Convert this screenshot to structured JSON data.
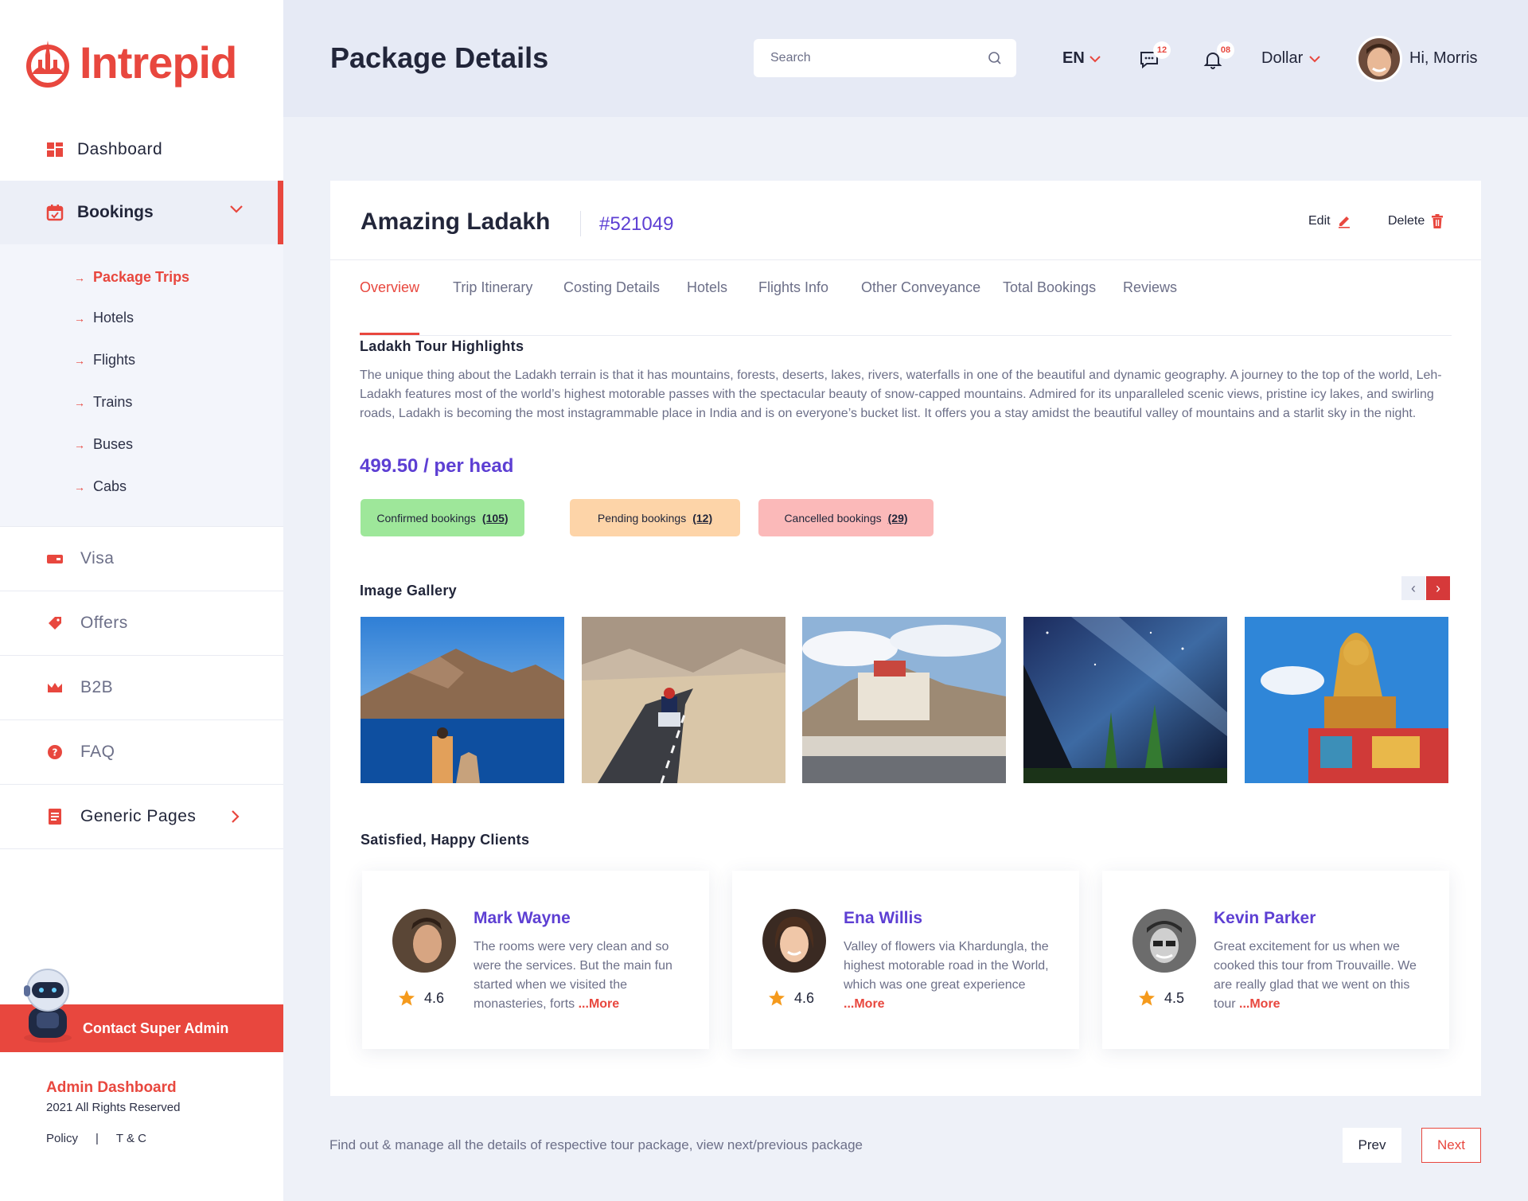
{
  "brand": {
    "name": "Intrepid",
    "accent": "#e8473e",
    "purple": "#5d3fd3"
  },
  "sidebar": {
    "items": [
      {
        "label": "Dashboard",
        "icon": "dashboard-icon"
      },
      {
        "label": "Bookings",
        "icon": "calendar-icon"
      },
      {
        "label": "Visa",
        "icon": "visa-card-icon"
      },
      {
        "label": "Offers",
        "icon": "tag-icon"
      },
      {
        "label": "B2B",
        "icon": "crown-icon"
      },
      {
        "label": "FAQ",
        "icon": "question-icon"
      },
      {
        "label": "Generic Pages",
        "icon": "document-icon"
      }
    ],
    "sub_items": [
      "Package Trips",
      "Hotels",
      "Flights",
      "Trains",
      "Buses",
      "Cabs"
    ],
    "contact_label": "Contact Super Admin",
    "footer": {
      "title": "Admin Dashboard",
      "rights": "2021 All Rights Reserved",
      "policy": "Policy",
      "separator": "|",
      "terms": "T & C"
    }
  },
  "header": {
    "title": "Package Details",
    "search_placeholder": "Search",
    "language": "EN",
    "messages_count": "12",
    "notifications_count": "08",
    "currency": "Dollar",
    "greeting": "Hi, Morris"
  },
  "package": {
    "name": "Amazing Ladakh",
    "id": "#521049",
    "edit_label": "Edit",
    "delete_label": "Delete",
    "tabs": [
      "Overview",
      "Trip Itinerary",
      "Costing Details",
      "Hotels",
      "Flights Info",
      "Other Conveyance",
      "Total Bookings",
      "Reviews"
    ],
    "active_tab": "Overview",
    "highlights_title": "Ladakh Tour Highlights",
    "highlights_text": "The unique thing about the Ladakh terrain is that it has mountains, forests, deserts, lakes, rivers, waterfalls in one of the beautiful and dynamic geography. A journey to the top of the world, Leh-Ladakh features most of the world’s highest motorable passes with the spectacular beauty of snow-capped mountains. Admired for its unparalleled scenic views, pristine icy lakes, and swirling roads, Ladakh is becoming the most instagrammable place in India and is on everyone’s bucket list. It offers you a stay amidst the beautiful valley of mountains and a starlit sky in the night.",
    "price": "499.50 / per head",
    "bookings": [
      {
        "label": "Confirmed bookings",
        "count": "(105)",
        "color": "#9ee79a"
      },
      {
        "label": "Pending bookings",
        "count": "(12)",
        "color": "#fdd4a8"
      },
      {
        "label": "Cancelled bookings",
        "count": "(29)",
        "color": "#fbb9b9"
      }
    ],
    "gallery_title": "Image Gallery",
    "gallery_prev": "‹",
    "gallery_next": "›",
    "gallery": [
      "mountain-lake-photo",
      "motorbike-road-photo",
      "monastery-photo",
      "starry-sky-photo",
      "buddha-statue-photo"
    ],
    "clients_title": "Satisfied, Happy Clients",
    "reviews": [
      {
        "name": "Mark Wayne",
        "rating": "4.6",
        "text": "The rooms were very clean and so were the services. But the main fun started when we visited the monasteries, forts ",
        "more": "...More"
      },
      {
        "name": "Ena Willis",
        "rating": "4.6",
        "text": "Valley of flowers via Khardungla, the highest motorable road in the World, which was one great experience ",
        "more": "...More"
      },
      {
        "name": "Kevin Parker",
        "rating": "4.5",
        "text": "Great excitement for us when we cooked this tour from Trouvaille. We are really glad that we went on this tour ",
        "more": "...More"
      }
    ]
  },
  "footer": {
    "note": "Find out & manage all the details of respective tour package, view next/previous package",
    "prev_label": "Prev",
    "next_label": "Next"
  }
}
